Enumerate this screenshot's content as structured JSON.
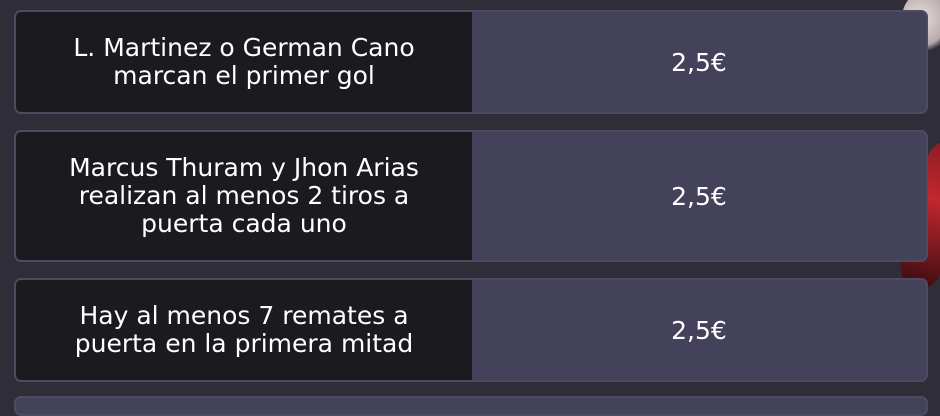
{
  "bets": [
    {
      "description": "L. Martinez o German Cano\nmarcan el primer gol",
      "odds": "2,5€"
    },
    {
      "description": "Marcus Thuram y Jhon Arias\nrealizan al menos 2 tiros a\npuerta cada uno",
      "odds": "2,5€"
    },
    {
      "description": "Hay al menos 7 remates a\npuerta en la primera mitad",
      "odds": "2,5€"
    }
  ],
  "colors": {
    "page_background": "#2e2d38",
    "card_background": "#43425a",
    "description_background": "#1b1a1f",
    "text": "#ffffff"
  }
}
